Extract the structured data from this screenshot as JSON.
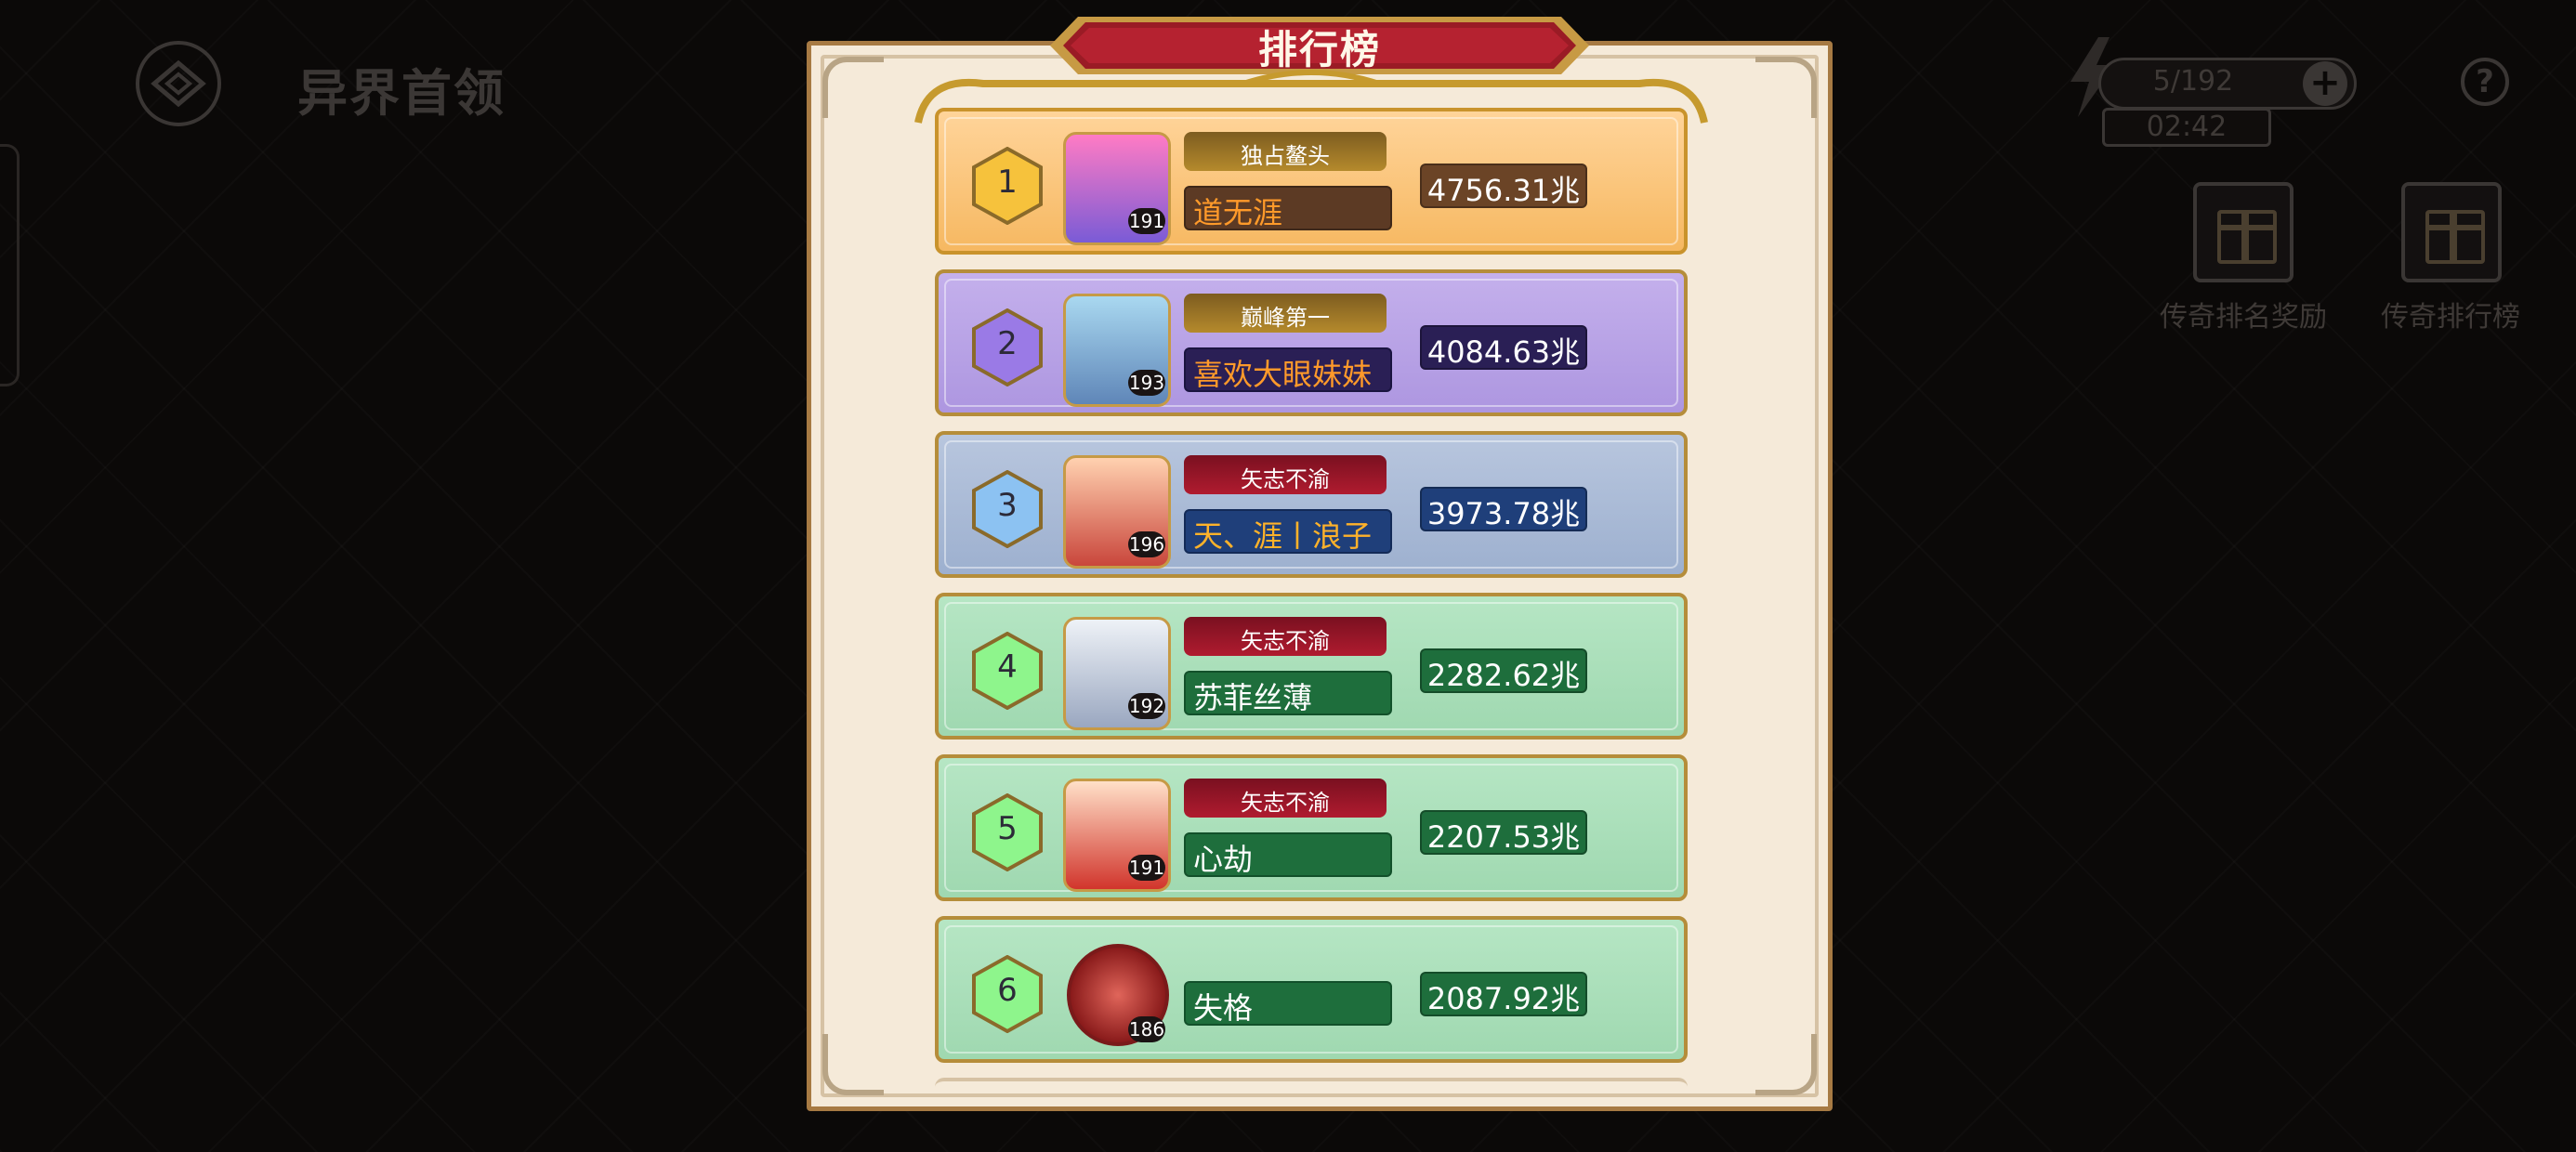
{
  "page": {
    "title": "异界首领"
  },
  "hud": {
    "energy": "5/192",
    "timer": "02:42",
    "plus_label": "+",
    "help_label": "?"
  },
  "side_buttons": [
    {
      "label": "传奇排名奖励",
      "icon": "gift-icon"
    },
    {
      "label": "传奇排行榜",
      "icon": "gift-icon"
    }
  ],
  "panel": {
    "title": "排行榜"
  },
  "rankings": [
    {
      "rank": "1",
      "title": "独占鳌头",
      "name": "道无涯",
      "score": "4756.31兆",
      "level": "191",
      "theme": "gold",
      "title_style": "gold",
      "name_color": "#ff9a2a",
      "score_color": "#6b4426"
    },
    {
      "rank": "2",
      "title": "巅峰第一",
      "name": "喜欢大眼妹妹",
      "score": "4084.63兆",
      "level": "193",
      "theme": "purple",
      "title_style": "gold",
      "name_color": "#ff9a2a",
      "score_color": "#2a1f55"
    },
    {
      "rank": "3",
      "title": "矢志不渝",
      "name": "天、涯丨浪子",
      "score": "3973.78兆",
      "level": "196",
      "theme": "blue",
      "title_style": "red",
      "name_color": "#ffb22a",
      "score_color": "#1f3f7a"
    },
    {
      "rank": "4",
      "title": "矢志不渝",
      "name": "苏菲丝薄",
      "score": "2282.62兆",
      "level": "192",
      "theme": "green",
      "title_style": "red",
      "name_color": "#ffffff",
      "score_color": "#1e6e3c"
    },
    {
      "rank": "5",
      "title": "矢志不渝",
      "name": "心劫",
      "score": "2207.53兆",
      "level": "191",
      "theme": "green",
      "title_style": "red",
      "name_color": "#ffffff",
      "score_color": "#1e6e3c"
    },
    {
      "rank": "6",
      "title": "",
      "name": "失格",
      "score": "2087.92兆",
      "level": "186",
      "theme": "green",
      "title_style": "none",
      "name_color": "#ffffff",
      "score_color": "#1e6e3c"
    }
  ],
  "colors": {
    "hex_gold": "#f6c23c",
    "hex_purple": "#9a7ae6",
    "hex_blue": "#8cc2f2",
    "hex_green": "#8ef58c"
  }
}
